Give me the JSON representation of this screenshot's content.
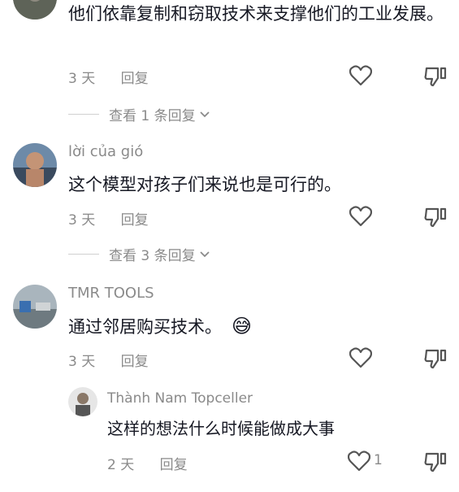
{
  "comments": [
    {
      "text": "他们依靠复制和窃取技术来支撑他们的工业发展。",
      "time": "3 天",
      "reply_label": "回复",
      "view_replies": "查看 1 条回复"
    },
    {
      "username": "lời của gió",
      "text": "这个模型对孩子们来说也是可行的。",
      "time": "3 天",
      "reply_label": "回复",
      "view_replies": "查看 3 条回复"
    },
    {
      "username": "TMR TOOLS",
      "text": "通过邻居购买技术。",
      "emoji": "😅",
      "time": "3 天",
      "reply_label": "回复",
      "reply": {
        "username": "Thành Nam Topceller",
        "text": "这样的想法什么时候能做成大事",
        "time": "2 天",
        "reply_label": "回复",
        "like_count": "1"
      }
    }
  ],
  "colors": {
    "primary_text": "#161823",
    "secondary_text": "#8a8a8a",
    "icon": "#555555"
  },
  "icons": [
    "heart-icon",
    "dislike-icon",
    "chevron-down-icon"
  ]
}
